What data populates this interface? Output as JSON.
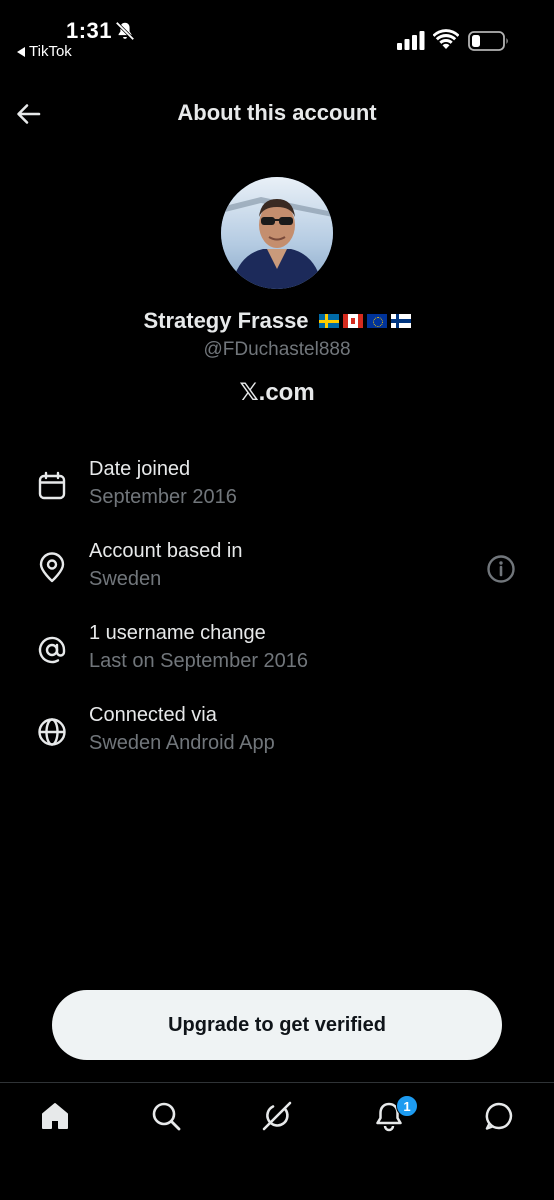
{
  "status_bar": {
    "time": "1:31",
    "back_app": "TikTok"
  },
  "header": {
    "title": "About this account"
  },
  "profile": {
    "display_name": "Strategy Frasse",
    "flags": [
      "Sweden",
      "Canada",
      "European Union",
      "Finland"
    ],
    "handle": "@FDuchastel888",
    "source": "𝕏.com"
  },
  "info": [
    {
      "icon": "calendar-icon",
      "title": "Date joined",
      "subtitle": "September 2016"
    },
    {
      "icon": "location-pin-icon",
      "title": "Account based in",
      "subtitle": "Sweden",
      "has_info_button": true
    },
    {
      "icon": "at-sign-icon",
      "title": "1 username change",
      "subtitle": "Last on September 2016"
    },
    {
      "icon": "globe-icon",
      "title": "Connected via",
      "subtitle": "Sweden Android App"
    }
  ],
  "upgrade_button": {
    "label": "Upgrade to get verified"
  },
  "bottom_nav": {
    "items": [
      "home-icon",
      "search-icon",
      "grok-icon",
      "notifications-icon",
      "messages-icon"
    ],
    "notifications_badge": "1"
  },
  "colors": {
    "background": "#000000",
    "primary_text": "#e7e9ea",
    "secondary_text": "#71767b",
    "badge": "#1d9bf0",
    "button_bg": "#eff3f4"
  }
}
